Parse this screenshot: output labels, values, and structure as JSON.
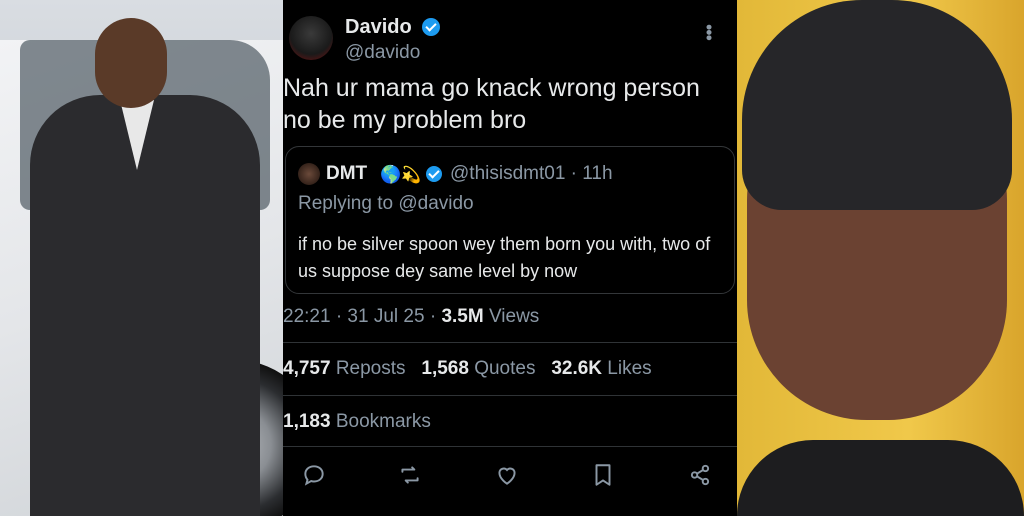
{
  "tweet": {
    "author_name": "Davido",
    "author_handle": "@davido",
    "text": "Nah ur mama go knack wrong person no be my problem bro",
    "quote": {
      "name": "DMT",
      "handle": "@thisisdmt01",
      "time": "· 11h",
      "replying_to": "Replying to @davido",
      "text": "if no be silver spoon wey them born you with, two of us suppose dey same level by now"
    },
    "timestamp": "22:21 · 31 Jul 25 · ",
    "views_count": "3.5M",
    "views_label": " Views",
    "reposts_count": "4,757",
    "reposts_label": " Reposts",
    "quotes_count": "1,568",
    "quotes_label": " Quotes",
    "likes_count": "32.6K",
    "likes_label": " Likes",
    "bookmarks_count": "1,183",
    "bookmarks_label": " Bookmarks",
    "icons": [
      "reply-icon",
      "repost-icon",
      "like-icon",
      "bookmark-icon",
      "share-icon"
    ]
  },
  "colors": {
    "background": "#000000",
    "text": "#e7e9ea",
    "muted": "#8b98a5",
    "verified": "#1d9bf0"
  }
}
